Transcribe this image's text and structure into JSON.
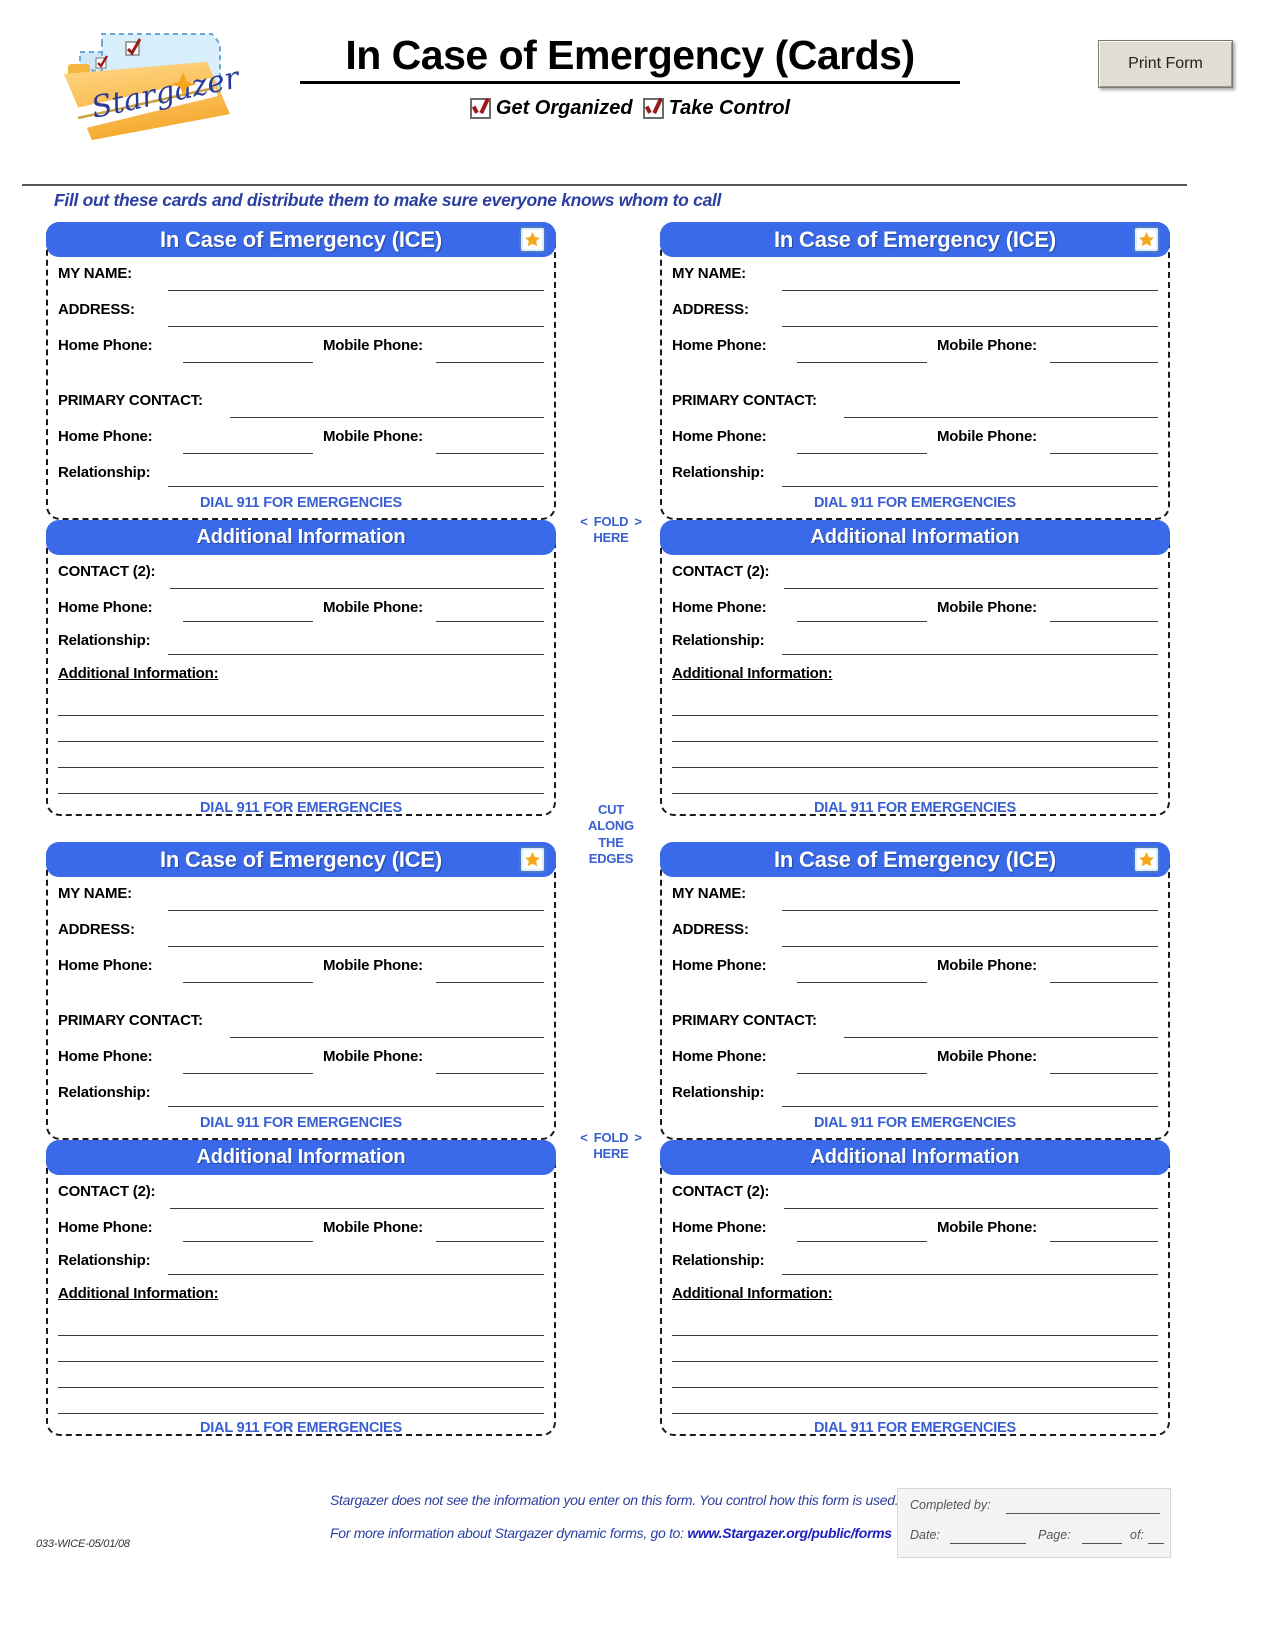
{
  "header": {
    "title": "In Case of Emergency (Cards)",
    "taglines": [
      {
        "icon": "checkbox-checked-icon",
        "label": "Get Organized"
      },
      {
        "icon": "checkbox-checked-icon",
        "label": "Take Control"
      }
    ],
    "print_button": "Print Form",
    "logo_alt": "Stargazer",
    "instruction": "Fill out these cards and distribute them to make sure everyone knows whom to call"
  },
  "card": {
    "front_title": "In Case of Emergency (ICE)",
    "back_title": "Additional Information",
    "icon": "stargazer-star-icon",
    "dial": "DIAL 911 FOR EMERGENCIES",
    "front_fields": {
      "name": "MY NAME:",
      "address": "ADDRESS:",
      "home_phone": "Home Phone:",
      "mobile_phone": "Mobile Phone:",
      "primary_contact": "PRIMARY CONTACT:",
      "contact_home_phone": "Home Phone:",
      "contact_mobile_phone": "Mobile Phone:",
      "relationship": "Relationship:"
    },
    "back_fields": {
      "contact2": "CONTACT (2):",
      "home_phone": "Home Phone:",
      "mobile_phone": "Mobile Phone:",
      "relationship": "Relationship:",
      "additional_information": "Additional Information:"
    }
  },
  "markers": {
    "fold_left_arrow": "<",
    "fold_right_arrow": ">",
    "fold_line1": "FOLD",
    "fold_line2": "HERE",
    "cut_line1": "CUT",
    "cut_line2": "ALONG",
    "cut_line3": "THE",
    "cut_line4": "EDGES"
  },
  "footer": {
    "privacy": "Stargazer does not see the information you enter on this form. You control how this form is used.",
    "more_info_prefix": "For more information about Stargazer dynamic forms, go to:",
    "url": "www.Stargazer.org/public/forms",
    "form_code": "033-WICE-05/01/08",
    "completed_by": "Completed by:",
    "date": "Date:",
    "page": "Page:",
    "of": "of:"
  },
  "colors": {
    "bar_blue": "#3a6aea",
    "text_blue": "#3a5fd0",
    "instruction_blue": "#2b3fa0"
  }
}
